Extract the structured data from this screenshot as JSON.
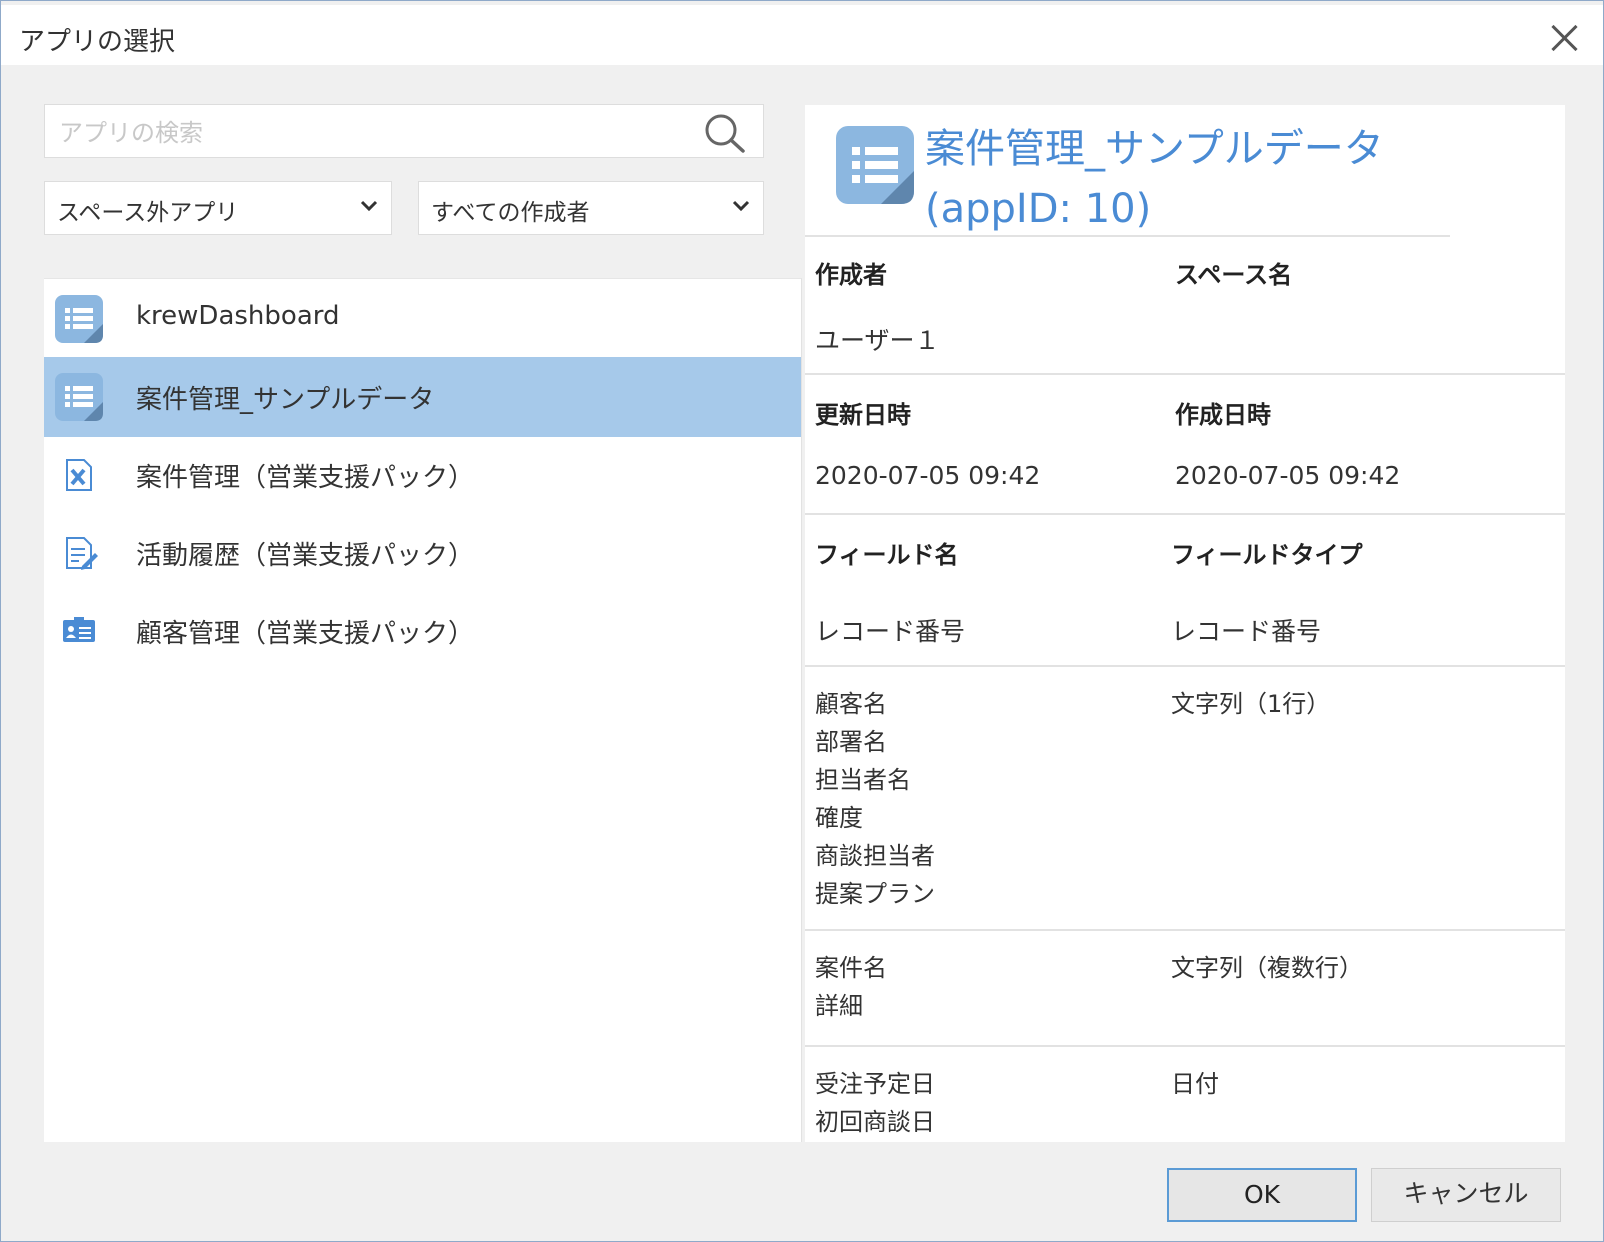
{
  "dialog": {
    "title": "アプリの選択"
  },
  "search": {
    "placeholder": "アプリの検索"
  },
  "filters": {
    "space": "スペース外アプリ",
    "creator": "すべての作成者"
  },
  "apps": [
    {
      "name": "krewDashboard",
      "icon": "table-list-icon",
      "selected": false
    },
    {
      "name": "案件管理_サンプルデータ",
      "icon": "table-list-icon",
      "selected": true
    },
    {
      "name": "案件管理（営業支援パック）",
      "icon": "document-x-icon",
      "selected": false
    },
    {
      "name": "活動履歴（営業支援パック）",
      "icon": "document-edit-icon",
      "selected": false
    },
    {
      "name": "顧客管理（営業支援パック）",
      "icon": "contact-card-icon",
      "selected": false
    }
  ],
  "detail": {
    "title_line1": "案件管理_サンプルデータ",
    "title_line2": "(appID: 10)",
    "creator_label": "作成者",
    "space_label": "スペース名",
    "creator_value": "ユーザー１",
    "updated_label": "更新日時",
    "created_label": "作成日時",
    "updated_value": "2020-07-05 09:42",
    "created_value": "2020-07-05 09:42",
    "field_name_label": "フィールド名",
    "field_type_label": "フィールドタイプ",
    "fields": [
      {
        "names": [
          "レコード番号"
        ],
        "type": "レコード番号"
      },
      {
        "names": [
          "顧客名",
          "部署名",
          "担当者名",
          "確度",
          "商談担当者",
          "提案プラン"
        ],
        "type": "文字列（1行）"
      },
      {
        "names": [
          "案件名",
          "詳細"
        ],
        "type": "文字列（複数行）"
      },
      {
        "names": [
          "受注予定日",
          "初回商談日"
        ],
        "type": "日付"
      }
    ]
  },
  "buttons": {
    "ok": "OK",
    "cancel": "キャンセル"
  },
  "colors": {
    "accent": "#4a8bd4",
    "selection": "#a6c9ea",
    "icon_blue": "#8cb7e0"
  }
}
